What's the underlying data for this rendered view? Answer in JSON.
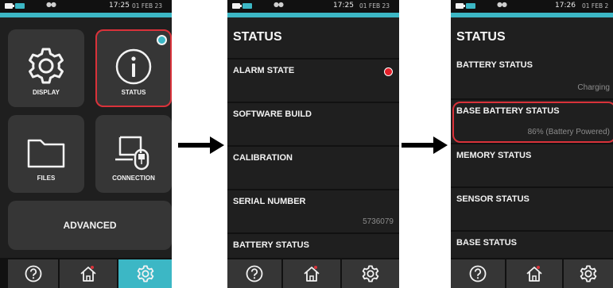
{
  "screens": [
    {
      "status_bar": {
        "time": "17:25",
        "date": "01 FEB 23"
      },
      "tiles": {
        "display": "DISPLAY",
        "status": "STATUS",
        "files": "FILES",
        "connection": "CONNECTION",
        "advanced": "ADVANCED"
      }
    },
    {
      "status_bar": {
        "time": "17:25",
        "date": "01 FEB 23"
      },
      "title": "STATUS",
      "rows": [
        {
          "label": "ALARM STATE",
          "value": ""
        },
        {
          "label": "SOFTWARE BUILD",
          "value": ""
        },
        {
          "label": "CALIBRATION",
          "value": ""
        },
        {
          "label": "SERIAL NUMBER",
          "value": "5736079"
        },
        {
          "label": "BATTERY STATUS",
          "value": ""
        }
      ]
    },
    {
      "status_bar": {
        "time": "17:26",
        "date": "01 FEB 2"
      },
      "title": "STATUS",
      "rows": [
        {
          "label": "BATTERY STATUS",
          "value": "Charging"
        },
        {
          "label": "BASE BATTERY STATUS",
          "value": "86% (Battery Powered)"
        },
        {
          "label": "MEMORY STATUS",
          "value": ""
        },
        {
          "label": "SENSOR STATUS",
          "value": ""
        },
        {
          "label": "BASE STATUS",
          "value": ""
        }
      ]
    }
  ],
  "colors": {
    "accent": "#3cb7c5",
    "highlight": "#d9323a",
    "alarm": "#e5202a",
    "background": "#1f1f1f",
    "tile": "#363636"
  },
  "icons": [
    "gear-icon",
    "info-icon",
    "folder-icon",
    "connection-icon",
    "help-icon",
    "home-icon",
    "settings-icon",
    "arrow-right-icon"
  ]
}
